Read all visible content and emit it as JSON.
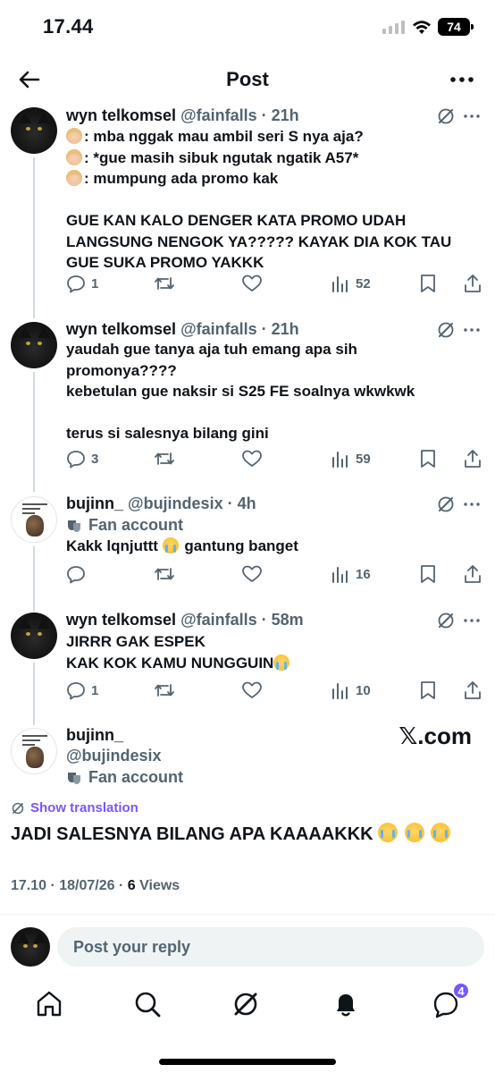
{
  "status_bar": {
    "time": "17.44",
    "battery": "74"
  },
  "header": {
    "title": "Post"
  },
  "posts": [
    {
      "name": "wyn telkomsel",
      "handle": "@fainfalls",
      "time": "21h",
      "lines": [
        ": mba nggak mau ambil seri S nya aja?",
        ": *gue masih sibuk ngutak ngatik A57*",
        ": mumpung ada promo kak",
        "",
        "GUE KAN KALO DENGER KATA PROMO UDAH",
        "LANGSUNG NENGOK YA????? KAYAK DIA KOK TAU",
        "GUE SUKA PROMO YAKKK"
      ],
      "replies": "1",
      "views": "52"
    },
    {
      "name": "wyn telkomsel",
      "handle": "@fainfalls",
      "time": "21h",
      "lines": [
        "yaudah gue tanya aja tuh emang apa sih",
        "promonya????",
        "kebetulan gue naksir si S25 FE soalnya wkwkwk",
        "",
        "terus si salesnya bilang gini"
      ],
      "replies": "3",
      "views": "59"
    },
    {
      "name": "bujinn_",
      "handle": "@bujindesix",
      "time": "4h",
      "badge": "Fan account",
      "lines": [
        "Kakk lqnjuttt",
        "gantung banget"
      ],
      "replies": "",
      "views": "16"
    },
    {
      "name": "wyn telkomsel",
      "handle": "@fainfalls",
      "time": "58m",
      "lines": [
        "JIRRR GAK ESPEK",
        "KAK KOK KAMU NUNGGUIN"
      ],
      "replies": "1",
      "views": "10"
    }
  ],
  "main_post": {
    "name": "bujinn_",
    "handle": "@bujindesix",
    "badge": "Fan account",
    "show_translation": "Show translation",
    "text": "JADI SALESNYA BILANG APA KAAAAKKK",
    "timestamp": "17.10 · 18/07/26 · ",
    "views_count": "6",
    "views_label": " Views",
    "watermark": "𝕏.com"
  },
  "reply": {
    "placeholder": "Post your reply"
  },
  "nav": {
    "messages_badge": "4"
  },
  "colors": {
    "accent": "#7856ff",
    "muted": "#536471",
    "text": "#0f1419",
    "line": "#cfd9de"
  }
}
